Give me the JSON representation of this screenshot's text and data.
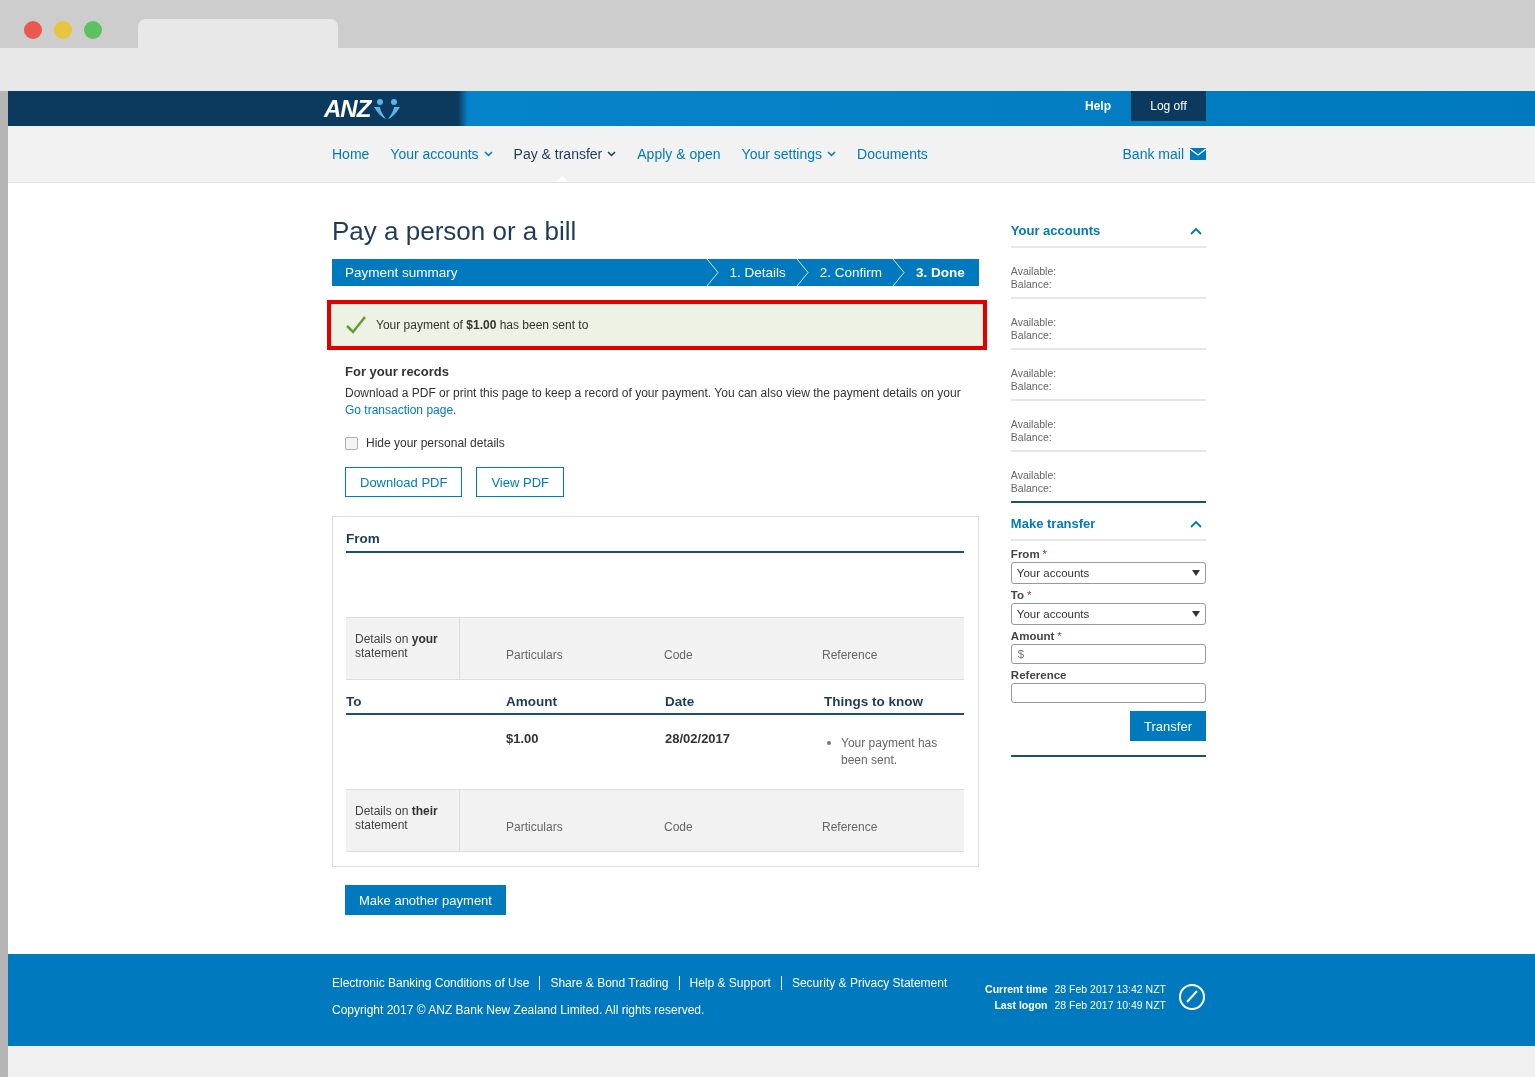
{
  "header": {
    "logo": "ANZ",
    "help": "Help",
    "logoff": "Log off"
  },
  "nav": {
    "items": [
      {
        "label": "Home",
        "dropdown": false,
        "selected": false
      },
      {
        "label": "Your accounts",
        "dropdown": true,
        "selected": false
      },
      {
        "label": "Pay & transfer",
        "dropdown": true,
        "selected": true
      },
      {
        "label": "Apply & open",
        "dropdown": false,
        "selected": false
      },
      {
        "label": "Your settings",
        "dropdown": true,
        "selected": false
      },
      {
        "label": "Documents",
        "dropdown": false,
        "selected": false
      }
    ],
    "bank_mail": "Bank mail"
  },
  "title": "Pay a person or a bill",
  "progress": {
    "label": "Payment summary",
    "steps": [
      {
        "label": "1. Details",
        "selected": false
      },
      {
        "label": "2. Confirm",
        "selected": false
      },
      {
        "label": "3. Done",
        "selected": true
      }
    ]
  },
  "success": {
    "text": "Your payment of **$1.00** has been sent to"
  },
  "records": {
    "heading": "For your records",
    "text": "Download a PDF or print this page to keep a record of your payment. You can also view the payment details on your",
    "link": "Go transaction page.",
    "checkbox": {
      "label": "Hide your personal details",
      "checked": false
    },
    "buttons": [
      "Download PDF",
      "View PDF"
    ]
  },
  "summary": {
    "from_heading": "From",
    "your_statement": {
      "label": "Details on **your** statement",
      "columns": [
        "Particulars",
        "Code",
        "Reference"
      ]
    },
    "to_columns": [
      "To",
      "Amount",
      "Date",
      "Things to know"
    ],
    "to_row": {
      "amount": "$1.00",
      "date": "28/02/2017",
      "notes": [
        "Your payment has been sent."
      ]
    },
    "their_statement": {
      "label": "Details on **their** statement",
      "columns": [
        "Particulars",
        "Code",
        "Reference"
      ]
    }
  },
  "another_button": "Make another payment",
  "sidebar": {
    "accounts": {
      "heading": "Your accounts",
      "expanded": true,
      "items": [
        {
          "available": "Available:",
          "balance": "Balance:"
        },
        {
          "available": "Available:",
          "balance": "Balance:"
        },
        {
          "available": "Available:",
          "balance": "Balance:"
        },
        {
          "available": "Available:",
          "balance": "Balance:"
        },
        {
          "available": "Available:",
          "balance": "Balance:"
        }
      ]
    },
    "transfer": {
      "heading": "Make transfer",
      "expanded": true,
      "fields": [
        {
          "label": "From",
          "required_mark": "*",
          "kind": "select",
          "value": "Your accounts"
        },
        {
          "label": "To",
          "required_mark": "*",
          "kind": "select",
          "value": "Your accounts"
        },
        {
          "label": "Amount",
          "required_mark": "*",
          "kind": "input",
          "placeholder": "$"
        },
        {
          "label": "Reference",
          "kind": "input"
        }
      ],
      "button": "Transfer"
    }
  },
  "footer": {
    "links": [
      "Electronic Banking Conditions of Use",
      "Share & Bond Trading",
      "Help & Support",
      "Security & Privacy Statement"
    ],
    "copyright": "Copyright 2017 © ANZ Bank New Zealand Limited. All rights reserved.",
    "times": [
      {
        "label": "Current time",
        "value": "28 Feb 2017 13:42 NZT"
      },
      {
        "label": "Last logon",
        "value": "28 Feb 2017 10:49 NZT"
      }
    ]
  }
}
